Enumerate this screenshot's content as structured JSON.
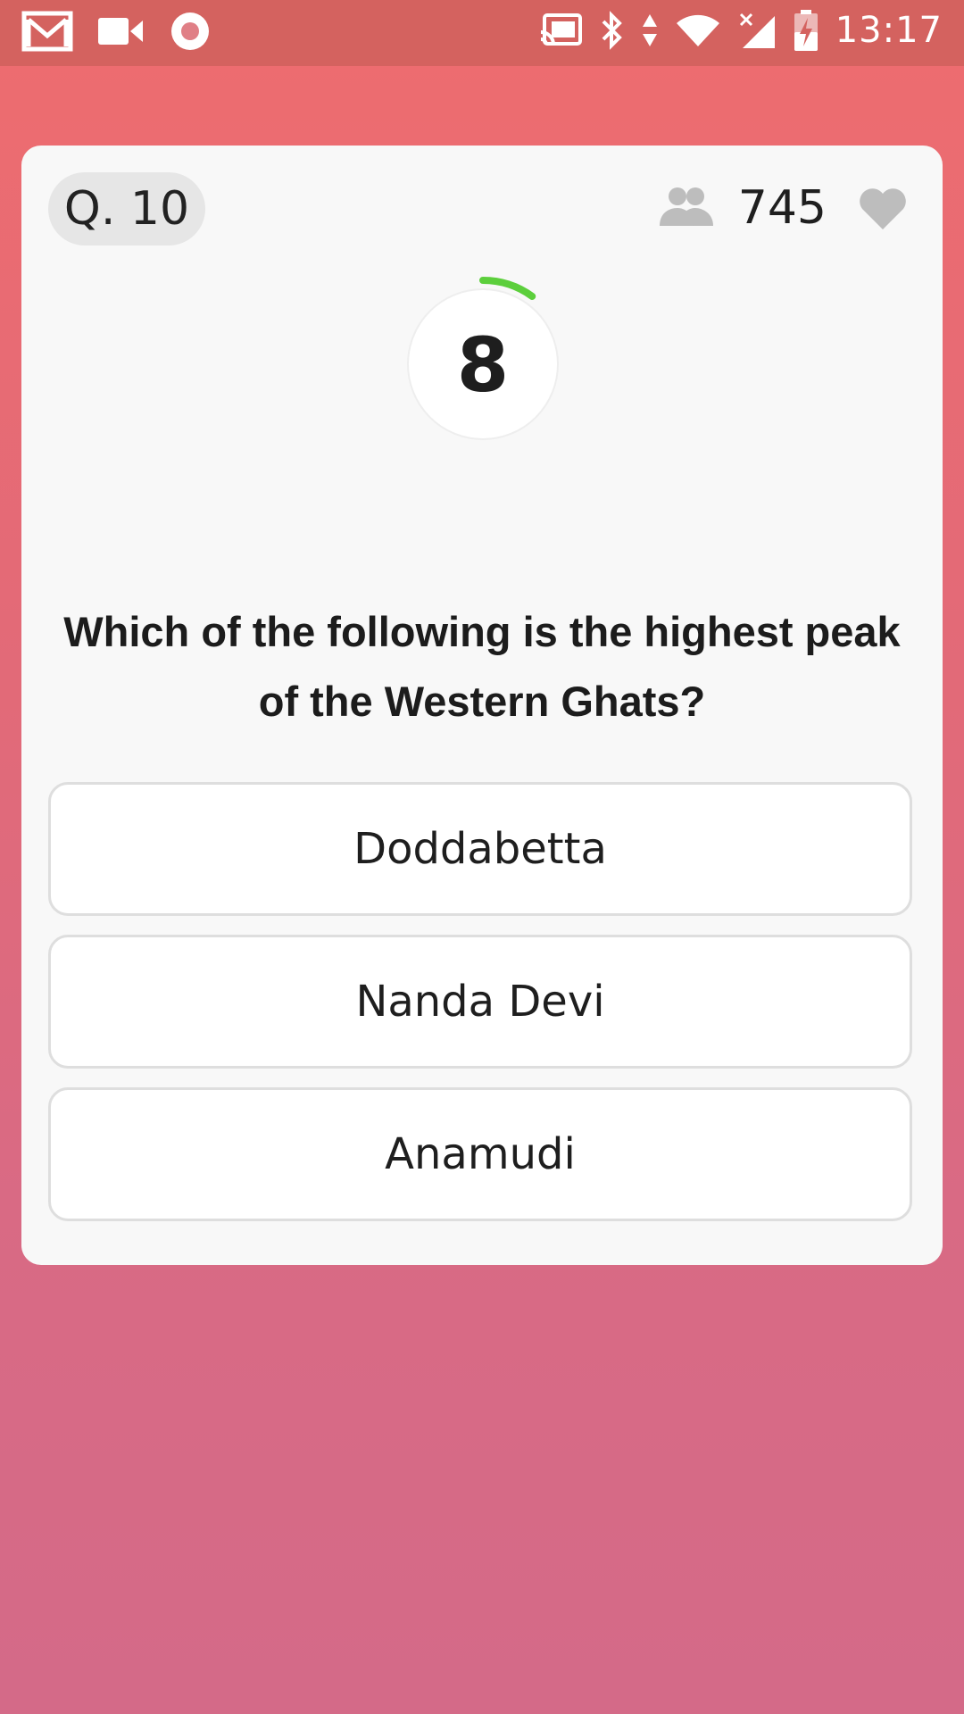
{
  "status_bar": {
    "time": "13:17",
    "left_icons": [
      "gmail-icon",
      "video-camera-icon",
      "record-icon"
    ],
    "right_icons": [
      "cast-icon",
      "bluetooth-icon",
      "data-arrows-icon",
      "wifi-icon",
      "signal-icon",
      "battery-charging-icon"
    ]
  },
  "quiz": {
    "question_number": "Q. 10",
    "viewer_count": "745",
    "timer_value": "8",
    "timer_progress": 0.1,
    "question": "Which of the following is the highest peak of the Western Ghats?",
    "options": [
      {
        "label": "Doddabetta"
      },
      {
        "label": "Nanda Devi"
      },
      {
        "label": "Anamudi"
      }
    ]
  },
  "colors": {
    "background_top": "#ee6c6f",
    "background_bottom": "#d46a88",
    "status_bar": "#d4625f",
    "card": "#f8f8f8",
    "timer_arc": "#5ccf3c",
    "icon_gray": "#bdbdbd"
  }
}
